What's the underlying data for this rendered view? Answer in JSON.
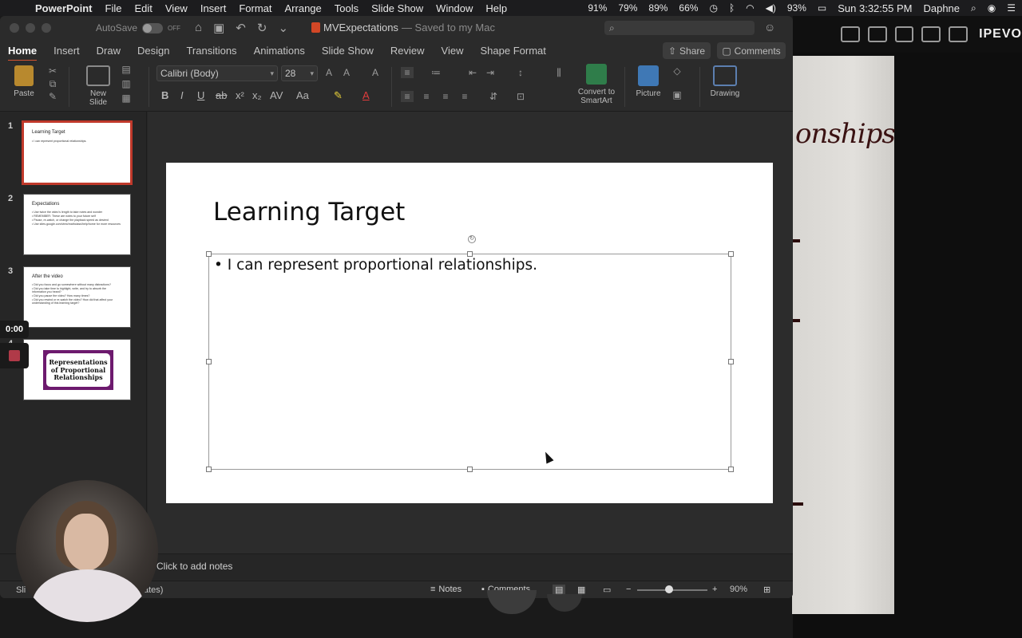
{
  "menubar": {
    "app_name": "PowerPoint",
    "menus": [
      "File",
      "Edit",
      "View",
      "Insert",
      "Format",
      "Arrange",
      "Tools",
      "Slide Show",
      "Window",
      "Help"
    ],
    "status": [
      "91%",
      "79%",
      "89%",
      "66%"
    ],
    "battery": "93%",
    "clock": "Sun 3:32:55 PM",
    "user": "Daphne"
  },
  "titlebar": {
    "autosave": "AutoSave",
    "autosave_state": "OFF",
    "doc_name": "MVExpectations",
    "saved_status": "— Saved to my Mac"
  },
  "tabs": [
    "Home",
    "Insert",
    "Draw",
    "Design",
    "Transitions",
    "Animations",
    "Slide Show",
    "Review",
    "View",
    "Shape Format"
  ],
  "share_label": "Share",
  "comments_label": "Comments",
  "ribbon": {
    "paste": "Paste",
    "new_slide": "New Slide",
    "font_name": "Calibri (Body)",
    "font_size": "28",
    "convert_smartart": "Convert to SmartArt",
    "picture": "Picture",
    "drawing": "Drawing"
  },
  "thumbnails": {
    "slide1": {
      "num": "1",
      "title": "Learning Target",
      "line": "• I can represent proportional relationships."
    },
    "slide2": {
      "num": "2",
      "title": "Expectations",
      "lines": [
        "• Use twice the video's length to take notes and wonder",
        "• REMEMBER: These are notes to your future self",
        "• Pause, re-watch, or change the playback speed as desired",
        "• Use sites.google.com/view/mathclass/help/home for more resources"
      ]
    },
    "slide3": {
      "num": "3",
      "title": "After the video",
      "lines": [
        "• Did you focus and go somewhere without many distractions?",
        "• Did you take time to highlight, write, and try to absorb the",
        "   information you heard?",
        "• Did you pause the video? How many times?",
        "• Did you rewind or re-watch the video? How did that affect your",
        "   understanding of this learning target?"
      ]
    },
    "slide4": {
      "num": "4",
      "title": "Representations of Proportional Relationships"
    }
  },
  "recording": {
    "time": "0:00"
  },
  "slide": {
    "title": "Learning Target",
    "bullet": "I can represent proportional relationships."
  },
  "notes_placeholder": "Click to add notes",
  "statusbar": {
    "left": "Sli",
    "left2": "ates)",
    "notes": "Notes",
    "comments": "Comments",
    "zoom": "90%",
    "zoom_level": 0.45
  },
  "camera": {
    "brand": "IPEVO",
    "handwriting": "onships"
  },
  "colors": {
    "accent": "#d35230",
    "record": "#b03a48",
    "thumb4_frame": "#6d1a6e"
  }
}
